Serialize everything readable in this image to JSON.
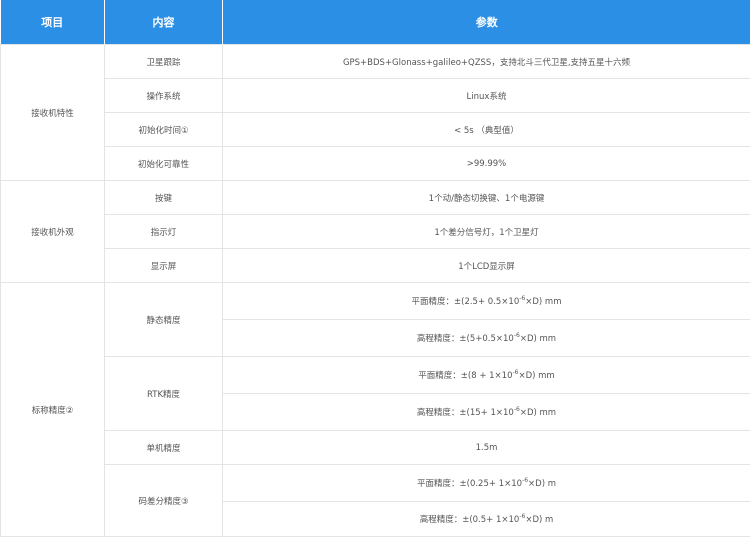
{
  "header": {
    "col1": "项目",
    "col2": "内容",
    "col3": "参数"
  },
  "rows": {
    "receiver": {
      "category": "接收机特性",
      "items": [
        {
          "name": "卫星跟踪",
          "value": "GPS+BDS+Glonass+galileo+QZSS，支持北斗三代卫星,支持五星十六频"
        },
        {
          "name": "操作系统",
          "value": "Linux系统"
        },
        {
          "name": "初始化时间①",
          "value": "< 5s （典型值）"
        },
        {
          "name": "初始化可靠性",
          "value": ">99.99%"
        }
      ]
    },
    "appearance": {
      "category": "接收机外观",
      "items": [
        {
          "name": "按键",
          "value": "1个动/静态切换键、1个电源键"
        },
        {
          "name": "指示灯",
          "value": "1个差分信号灯，1个卫星灯"
        },
        {
          "name": "显示屏",
          "value": "1个LCD显示屏"
        }
      ]
    },
    "accuracy": {
      "category": "标称精度②",
      "static": {
        "name": "静态精度",
        "plane": {
          "pre": "平面精度：±(2.5+ 0.5×10",
          "exp": "-6",
          "post": "×D) mm"
        },
        "height": {
          "pre": "高程精度：±(5+0.5×10",
          "exp": "-6",
          "post": "×D) mm"
        }
      },
      "rtk": {
        "name": "RTK精度",
        "plane": {
          "pre": "平面精度：±(8 + 1×10",
          "exp": "-6",
          "post": "×D) mm"
        },
        "height": {
          "pre": "高程精度：±(15+ 1×10",
          "exp": "-6",
          "post": "×D) mm"
        }
      },
      "single": {
        "name": "单机精度",
        "value": "1.5m"
      },
      "code_diff": {
        "name": "码差分精度③",
        "plane": {
          "pre": "平面精度：±(0.25+ 1×10",
          "exp": "-6",
          "post": "×D) m"
        },
        "height": {
          "pre": "高程精度：±(0.5+ 1×10",
          "exp": "-6",
          "post": "×D) m"
        }
      }
    }
  }
}
